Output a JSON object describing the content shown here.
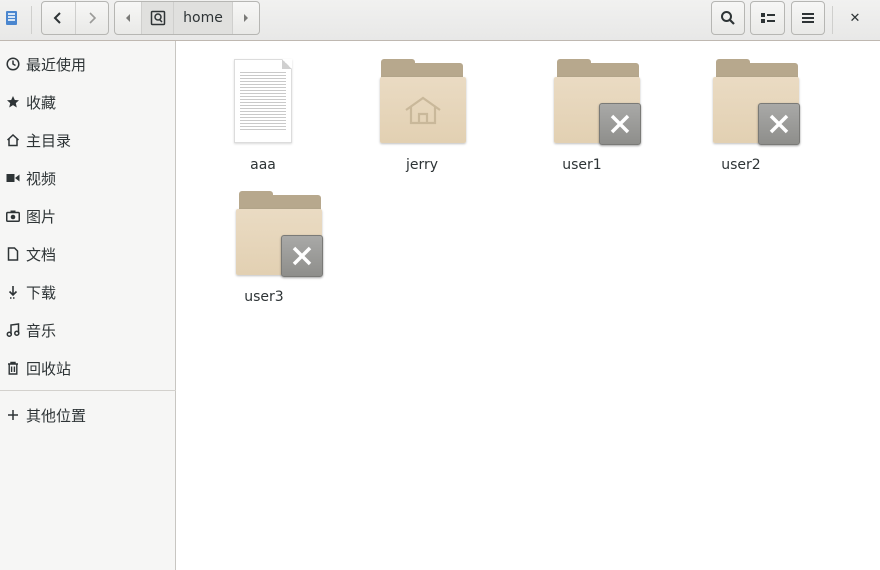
{
  "headerbar": {
    "app_icon": "files-app-icon",
    "back_icon": "go-back-icon",
    "forward_icon": "go-forward-icon",
    "path_left_icon": "path-scroll-left-icon",
    "path_root_icon": "disk-root-icon",
    "path_current": "home",
    "path_right_icon": "path-scroll-right-icon",
    "search_icon": "search-icon",
    "view_icon": "view-list-icon",
    "menu_icon": "menu-icon",
    "close_label": "✕"
  },
  "sidebar": {
    "items": [
      {
        "label": "最近使用",
        "icon": "recent-icon"
      },
      {
        "label": "收藏",
        "icon": "star-icon"
      },
      {
        "label": "主目录",
        "icon": "home-icon"
      },
      {
        "label": "视频",
        "icon": "video-icon"
      },
      {
        "label": "图片",
        "icon": "camera-icon"
      },
      {
        "label": "文档",
        "icon": "document-icon"
      },
      {
        "label": "下载",
        "icon": "download-icon"
      },
      {
        "label": "音乐",
        "icon": "music-icon"
      },
      {
        "label": "回收站",
        "icon": "trash-icon"
      }
    ],
    "other": {
      "label": "其他位置",
      "icon": "plus-icon"
    }
  },
  "files": [
    {
      "name": "aaa",
      "type": "text-document"
    },
    {
      "name": "jerry",
      "type": "home-folder"
    },
    {
      "name": "user1",
      "type": "folder-no-access"
    },
    {
      "name": "user2",
      "type": "folder-no-access"
    },
    {
      "name": "user3",
      "type": "folder-no-access"
    }
  ],
  "colors": {
    "folder_front": "#eadbc3",
    "folder_back": "#b7a88d",
    "badge": "#9c9c99",
    "accent": "#4a86cf"
  }
}
